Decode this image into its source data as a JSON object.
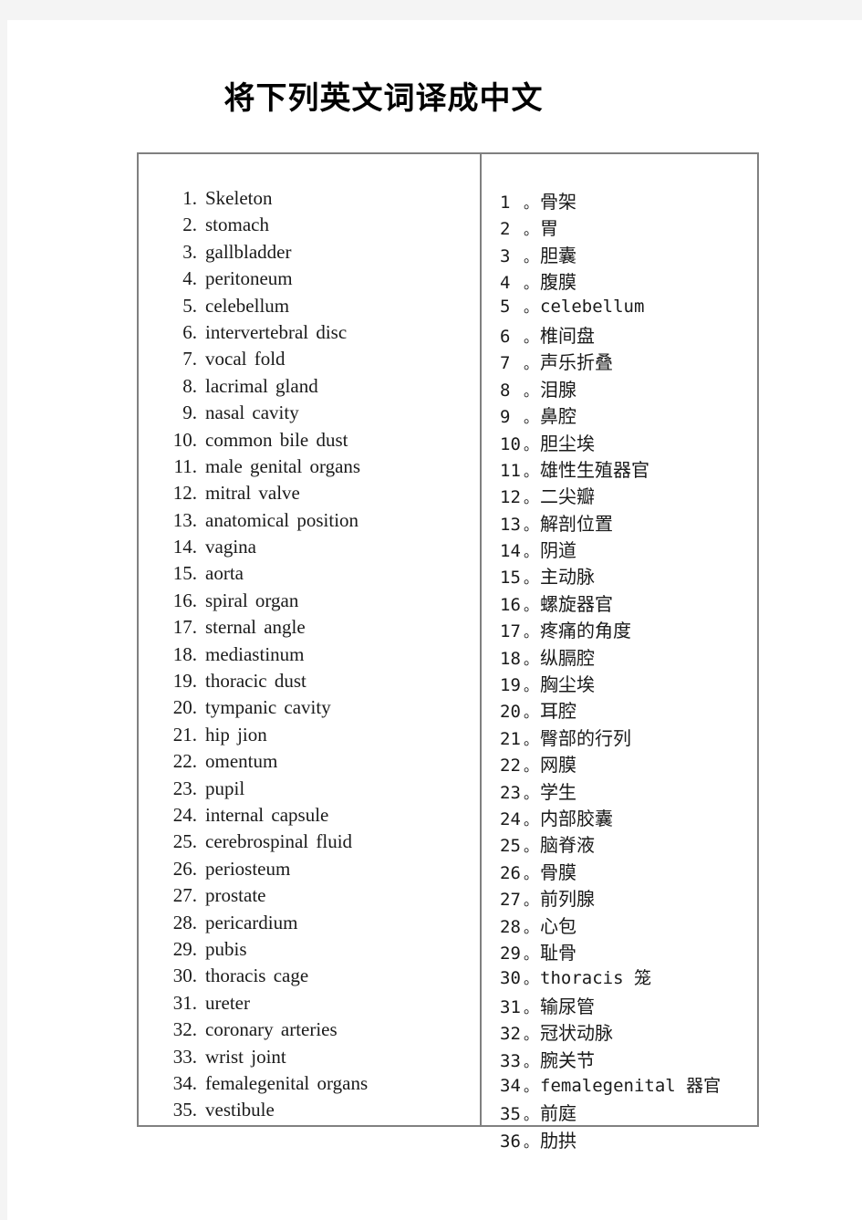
{
  "document": {
    "title": "将下列英文词译成中文"
  },
  "table": {
    "english_column": [
      {
        "number": "1.",
        "term": "Skeleton"
      },
      {
        "number": "2.",
        "term": "stomach"
      },
      {
        "number": "3.",
        "term": "gallbladder"
      },
      {
        "number": "4.",
        "term": "peritoneum"
      },
      {
        "number": "5.",
        "term": "celebellum"
      },
      {
        "number": "6.",
        "term": "intervertebral  disc"
      },
      {
        "number": "7.",
        "term": "vocal  fold"
      },
      {
        "number": "8.",
        "term": "lacrimal  gland"
      },
      {
        "number": "9.",
        "term": "nasal  cavity"
      },
      {
        "number": "10.",
        "term": "common  bile  dust"
      },
      {
        "number": "11.",
        "term": "male  genital  organs"
      },
      {
        "number": "12.",
        "term": "mitral  valve"
      },
      {
        "number": "13.",
        "term": "anatomical  position"
      },
      {
        "number": "14.",
        "term": "vagina"
      },
      {
        "number": "15.",
        "term": "aorta"
      },
      {
        "number": "16.",
        "term": "spiral  organ"
      },
      {
        "number": "17.",
        "term": "sternal  angle"
      },
      {
        "number": "18.",
        "term": "mediastinum"
      },
      {
        "number": "19.",
        "term": "thoracic  dust"
      },
      {
        "number": "20.",
        "term": "tympanic  cavity"
      },
      {
        "number": "21.",
        "term": "hip  jion"
      },
      {
        "number": "22.",
        "term": "omentum"
      },
      {
        "number": "23.",
        "term": "pupil"
      },
      {
        "number": "24.",
        "term": "internal  capsule"
      },
      {
        "number": "25.",
        "term": "cerebrospinal  fluid"
      },
      {
        "number": "26.",
        "term": "periosteum"
      },
      {
        "number": "27.",
        "term": "prostate"
      },
      {
        "number": "28.",
        "term": "pericardium"
      },
      {
        "number": "29.",
        "term": "pubis"
      },
      {
        "number": "30.",
        "term": "thoracis  cage"
      },
      {
        "number": "31.",
        "term": "ureter"
      },
      {
        "number": "32.",
        "term": "coronary  arteries"
      },
      {
        "number": "33.",
        "term": "wrist  joint"
      },
      {
        "number": "34.",
        "term": "femalegenital  organs"
      },
      {
        "number": "35.",
        "term": "vestibule"
      }
    ],
    "chinese_column": [
      {
        "number": "1",
        "separator": "。",
        "term": "骨架",
        "latin": false
      },
      {
        "number": "2",
        "separator": "。",
        "term": "胃",
        "latin": false
      },
      {
        "number": "3",
        "separator": "。",
        "term": "胆囊",
        "latin": false
      },
      {
        "number": "4",
        "separator": "。",
        "term": "腹膜",
        "latin": false
      },
      {
        "number": "5",
        "separator": "。",
        "term": "celebellum",
        "latin": true
      },
      {
        "number": "6",
        "separator": "。",
        "term": "椎间盘",
        "latin": false
      },
      {
        "number": "7",
        "separator": "。",
        "term": "声乐折叠",
        "latin": false
      },
      {
        "number": "8",
        "separator": "。",
        "term": "泪腺",
        "latin": false
      },
      {
        "number": "9",
        "separator": "。",
        "term": "鼻腔",
        "latin": false
      },
      {
        "number": "10",
        "separator": "。",
        "term": "胆尘埃",
        "latin": false
      },
      {
        "number": "11",
        "separator": "。",
        "term": "雄性生殖器官",
        "latin": false
      },
      {
        "number": "12",
        "separator": "。",
        "term": "二尖瓣",
        "latin": false
      },
      {
        "number": "13",
        "separator": "。",
        "term": "解剖位置",
        "latin": false
      },
      {
        "number": "14",
        "separator": "。",
        "term": "阴道",
        "latin": false
      },
      {
        "number": "15",
        "separator": "。",
        "term": "主动脉",
        "latin": false
      },
      {
        "number": "16",
        "separator": "。",
        "term": "螺旋器官",
        "latin": false
      },
      {
        "number": "17",
        "separator": "。",
        "term": "疼痛的角度",
        "latin": false
      },
      {
        "number": "18",
        "separator": "。",
        "term": "纵膈腔",
        "latin": false
      },
      {
        "number": "19",
        "separator": "。",
        "term": "胸尘埃",
        "latin": false
      },
      {
        "number": "20",
        "separator": "。",
        "term": "耳腔",
        "latin": false
      },
      {
        "number": "21",
        "separator": "。",
        "term": "臀部的行列",
        "latin": false
      },
      {
        "number": "22",
        "separator": "。",
        "term": "网膜",
        "latin": false
      },
      {
        "number": "23",
        "separator": "。",
        "term": "学生",
        "latin": false
      },
      {
        "number": "24",
        "separator": "。",
        "term": "内部胶囊",
        "latin": false
      },
      {
        "number": "25",
        "separator": "。",
        "term": "脑脊液",
        "latin": false
      },
      {
        "number": "26",
        "separator": "。",
        "term": "骨膜",
        "latin": false
      },
      {
        "number": "27",
        "separator": "。",
        "term": "前列腺",
        "latin": false
      },
      {
        "number": "28",
        "separator": "。",
        "term": "心包",
        "latin": false
      },
      {
        "number": "29",
        "separator": "。",
        "term": "耻骨",
        "latin": false
      },
      {
        "number": "30",
        "separator": "。",
        "term": "thoracis 笼",
        "latin": true
      },
      {
        "number": "31",
        "separator": "。",
        "term": "输尿管",
        "latin": false
      },
      {
        "number": "32",
        "separator": "。",
        "term": "冠状动脉",
        "latin": false
      },
      {
        "number": "33",
        "separator": "。",
        "term": "腕关节",
        "latin": false
      },
      {
        "number": "34",
        "separator": "。",
        "term": "femalegenital 器官",
        "latin": true
      },
      {
        "number": "35",
        "separator": "。",
        "term": "前庭",
        "latin": false
      },
      {
        "number": "36",
        "separator": "。",
        "term": "肋拱",
        "latin": false
      }
    ]
  },
  "colors": {
    "page_background": "#ffffff",
    "desk_background": "#f4f4f4",
    "table_border": "#808080",
    "text": "#1a1a1a"
  }
}
